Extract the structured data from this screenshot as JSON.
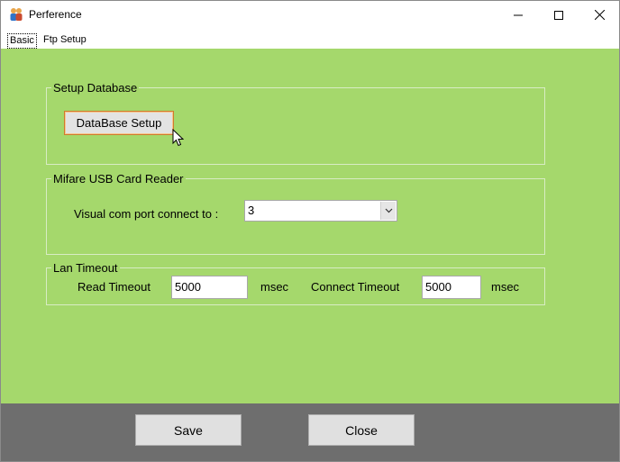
{
  "window": {
    "title": "Perference"
  },
  "tabs": [
    {
      "label": "Basic"
    },
    {
      "label": "Ftp Setup"
    }
  ],
  "setup_database": {
    "group_label": "Setup Database",
    "button_label": "DataBase Setup"
  },
  "card_reader": {
    "group_label": "Mifare USB Card Reader",
    "port_label": "Visual com port connect to :",
    "port_value": "3"
  },
  "lan_timeout": {
    "group_label": "Lan Timeout",
    "read_label": "Read Timeout",
    "read_value": "5000",
    "read_unit": "msec",
    "connect_label": "Connect Timeout",
    "connect_value": "5000",
    "connect_unit": "msec"
  },
  "footer": {
    "save_label": "Save",
    "close_label": "Close"
  },
  "colors": {
    "panel": "#a5d86c",
    "footer": "#6e6e6e",
    "button_focus": "#cf7a2d"
  },
  "icons": [
    "app-icon",
    "minimize-icon",
    "maximize-icon",
    "close-icon",
    "chevron-down-icon",
    "mouse-cursor-icon"
  ]
}
